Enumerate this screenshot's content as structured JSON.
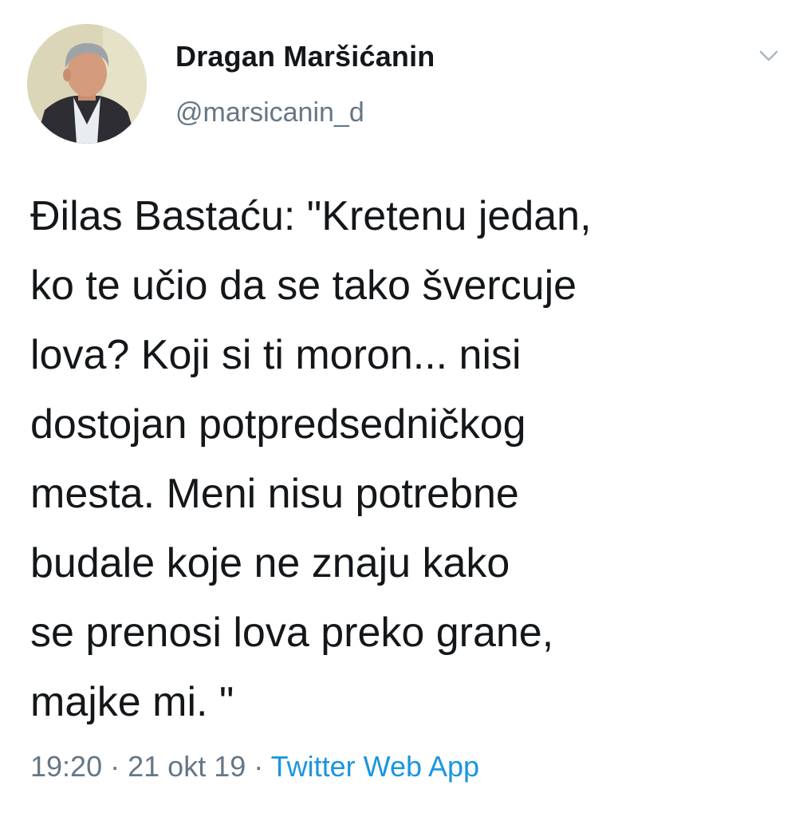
{
  "tweet": {
    "display_name": "Dragan Maršićanin",
    "handle": "@marsicanin_d",
    "text": "Đilas Bastaću: \"Kretenu jedan,\nko te učio da se tako švercuje\nlova? Koji si ti moron... nisi\ndostojan potpredsedničkog\nmesta. Meni nisu potrebne\nbudale koje ne znaju kako\nse prenosi lova preko grane,\nmajke mi. \"",
    "time": "19:20",
    "separator": "·",
    "date": "21 okt 19",
    "source": "Twitter Web App",
    "icons": {
      "avatar": "profile-photo",
      "menu": "chevron-down-icon"
    },
    "colors": {
      "text": "#14171a",
      "muted": "#657786",
      "link": "#1b95e0"
    }
  }
}
